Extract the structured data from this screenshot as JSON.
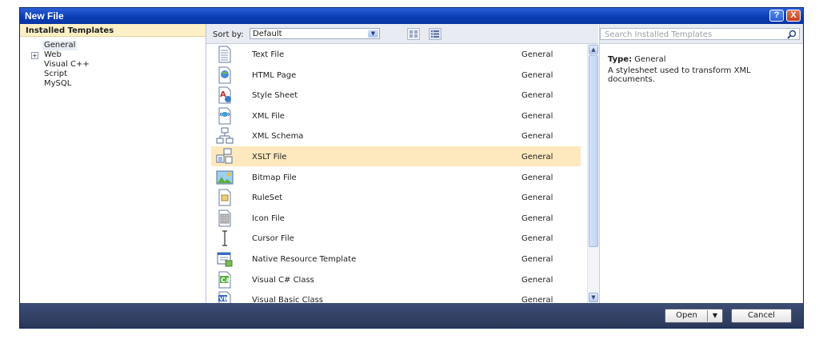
{
  "window": {
    "title": "New File",
    "help_label": "?",
    "close_label": "X"
  },
  "left_panel": {
    "header": "Installed Templates",
    "items": [
      {
        "label": "General",
        "selected": true,
        "expandable": false
      },
      {
        "label": "Web",
        "selected": false,
        "expandable": true
      },
      {
        "label": "Visual C++",
        "selected": false,
        "expandable": false
      },
      {
        "label": "Script",
        "selected": false,
        "expandable": false
      },
      {
        "label": "MySQL",
        "selected": false,
        "expandable": false
      }
    ]
  },
  "toolbar": {
    "sort_label": "Sort by:",
    "sort_value": "Default"
  },
  "templates": [
    {
      "name": "Text File",
      "category": "General",
      "icon": "text-file-icon"
    },
    {
      "name": "HTML Page",
      "category": "General",
      "icon": "html-page-icon"
    },
    {
      "name": "Style Sheet",
      "category": "General",
      "icon": "style-sheet-icon"
    },
    {
      "name": "XML File",
      "category": "General",
      "icon": "xml-file-icon"
    },
    {
      "name": "XML Schema",
      "category": "General",
      "icon": "xml-schema-icon"
    },
    {
      "name": "XSLT File",
      "category": "General",
      "icon": "xslt-file-icon",
      "selected": true
    },
    {
      "name": "Bitmap File",
      "category": "General",
      "icon": "bitmap-file-icon"
    },
    {
      "name": "RuleSet",
      "category": "General",
      "icon": "ruleset-icon"
    },
    {
      "name": "Icon File",
      "category": "General",
      "icon": "icon-file-icon"
    },
    {
      "name": "Cursor File",
      "category": "General",
      "icon": "cursor-file-icon"
    },
    {
      "name": "Native Resource Template",
      "category": "General",
      "icon": "native-resource-icon"
    },
    {
      "name": "Visual C# Class",
      "category": "General",
      "icon": "csharp-class-icon"
    },
    {
      "name": "Visual Basic Class",
      "category": "General",
      "icon": "vb-class-icon"
    }
  ],
  "search": {
    "placeholder": "Search Installed Templates"
  },
  "details": {
    "type_label": "Type:",
    "type_value": "General",
    "description": "A stylesheet used to transform XML documents."
  },
  "buttons": {
    "open": "Open",
    "cancel": "Cancel"
  },
  "colors": {
    "selection": "#fde9bd",
    "titlebar": "#0a3fb8",
    "footer": "#2a3858"
  }
}
